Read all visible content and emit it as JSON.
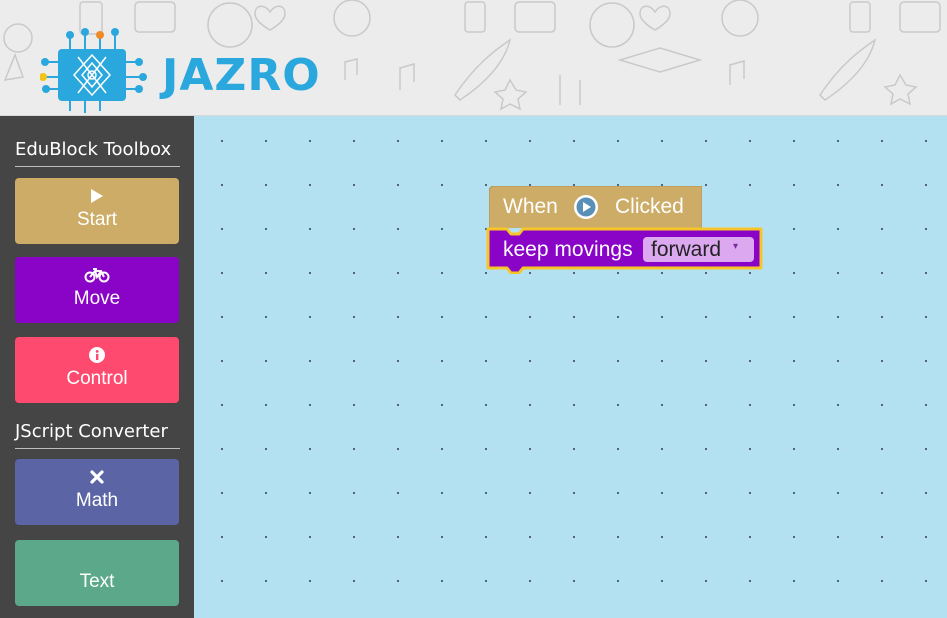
{
  "app": {
    "brand": "JAZRO"
  },
  "toolbox": {
    "title": "EduBlock Toolbox",
    "buttons": [
      {
        "label": "Start",
        "icon": "play-icon",
        "color": "#ccac66"
      },
      {
        "label": "Move",
        "icon": "bicycle-icon",
        "color": "#8a04c8"
      },
      {
        "label": "Control",
        "icon": "info-icon",
        "color": "#fd4a6e"
      }
    ]
  },
  "converter": {
    "title": "JScript Converter",
    "buttons": [
      {
        "label": "Math",
        "icon": "times-icon",
        "color": "#5b64a5"
      },
      {
        "label": "Text",
        "icon": "",
        "color": "#5ba88a"
      }
    ]
  },
  "workspace": {
    "background": "#b3e1f2",
    "blocks": {
      "hat": {
        "prefix": "When",
        "icon": "play-circle-icon",
        "suffix": "Clicked",
        "color": "#ccac66"
      },
      "move": {
        "label": "keep movings",
        "dropdown_value": "forward",
        "dropdown_arrow": "▾",
        "color": "#8a04c8",
        "highlight": "#f7c528"
      }
    }
  }
}
